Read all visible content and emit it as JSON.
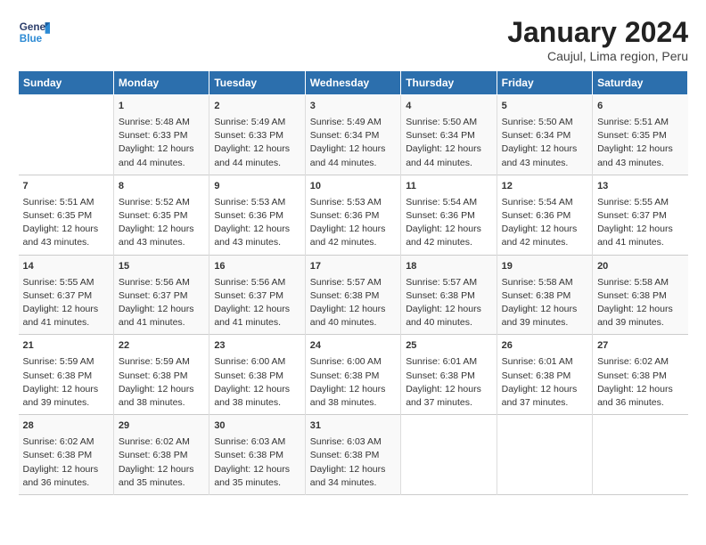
{
  "logo": {
    "line1": "General",
    "line2": "Blue"
  },
  "title": "January 2024",
  "subtitle": "Caujul, Lima region, Peru",
  "days_of_week": [
    "Sunday",
    "Monday",
    "Tuesday",
    "Wednesday",
    "Thursday",
    "Friday",
    "Saturday"
  ],
  "weeks": [
    [
      {
        "day": "",
        "info": ""
      },
      {
        "day": "1",
        "info": "Sunrise: 5:48 AM\nSunset: 6:33 PM\nDaylight: 12 hours\nand 44 minutes."
      },
      {
        "day": "2",
        "info": "Sunrise: 5:49 AM\nSunset: 6:33 PM\nDaylight: 12 hours\nand 44 minutes."
      },
      {
        "day": "3",
        "info": "Sunrise: 5:49 AM\nSunset: 6:34 PM\nDaylight: 12 hours\nand 44 minutes."
      },
      {
        "day": "4",
        "info": "Sunrise: 5:50 AM\nSunset: 6:34 PM\nDaylight: 12 hours\nand 44 minutes."
      },
      {
        "day": "5",
        "info": "Sunrise: 5:50 AM\nSunset: 6:34 PM\nDaylight: 12 hours\nand 43 minutes."
      },
      {
        "day": "6",
        "info": "Sunrise: 5:51 AM\nSunset: 6:35 PM\nDaylight: 12 hours\nand 43 minutes."
      }
    ],
    [
      {
        "day": "7",
        "info": "Sunrise: 5:51 AM\nSunset: 6:35 PM\nDaylight: 12 hours\nand 43 minutes."
      },
      {
        "day": "8",
        "info": "Sunrise: 5:52 AM\nSunset: 6:35 PM\nDaylight: 12 hours\nand 43 minutes."
      },
      {
        "day": "9",
        "info": "Sunrise: 5:53 AM\nSunset: 6:36 PM\nDaylight: 12 hours\nand 43 minutes."
      },
      {
        "day": "10",
        "info": "Sunrise: 5:53 AM\nSunset: 6:36 PM\nDaylight: 12 hours\nand 42 minutes."
      },
      {
        "day": "11",
        "info": "Sunrise: 5:54 AM\nSunset: 6:36 PM\nDaylight: 12 hours\nand 42 minutes."
      },
      {
        "day": "12",
        "info": "Sunrise: 5:54 AM\nSunset: 6:36 PM\nDaylight: 12 hours\nand 42 minutes."
      },
      {
        "day": "13",
        "info": "Sunrise: 5:55 AM\nSunset: 6:37 PM\nDaylight: 12 hours\nand 41 minutes."
      }
    ],
    [
      {
        "day": "14",
        "info": "Sunrise: 5:55 AM\nSunset: 6:37 PM\nDaylight: 12 hours\nand 41 minutes."
      },
      {
        "day": "15",
        "info": "Sunrise: 5:56 AM\nSunset: 6:37 PM\nDaylight: 12 hours\nand 41 minutes."
      },
      {
        "day": "16",
        "info": "Sunrise: 5:56 AM\nSunset: 6:37 PM\nDaylight: 12 hours\nand 41 minutes."
      },
      {
        "day": "17",
        "info": "Sunrise: 5:57 AM\nSunset: 6:38 PM\nDaylight: 12 hours\nand 40 minutes."
      },
      {
        "day": "18",
        "info": "Sunrise: 5:57 AM\nSunset: 6:38 PM\nDaylight: 12 hours\nand 40 minutes."
      },
      {
        "day": "19",
        "info": "Sunrise: 5:58 AM\nSunset: 6:38 PM\nDaylight: 12 hours\nand 39 minutes."
      },
      {
        "day": "20",
        "info": "Sunrise: 5:58 AM\nSunset: 6:38 PM\nDaylight: 12 hours\nand 39 minutes."
      }
    ],
    [
      {
        "day": "21",
        "info": "Sunrise: 5:59 AM\nSunset: 6:38 PM\nDaylight: 12 hours\nand 39 minutes."
      },
      {
        "day": "22",
        "info": "Sunrise: 5:59 AM\nSunset: 6:38 PM\nDaylight: 12 hours\nand 38 minutes."
      },
      {
        "day": "23",
        "info": "Sunrise: 6:00 AM\nSunset: 6:38 PM\nDaylight: 12 hours\nand 38 minutes."
      },
      {
        "day": "24",
        "info": "Sunrise: 6:00 AM\nSunset: 6:38 PM\nDaylight: 12 hours\nand 38 minutes."
      },
      {
        "day": "25",
        "info": "Sunrise: 6:01 AM\nSunset: 6:38 PM\nDaylight: 12 hours\nand 37 minutes."
      },
      {
        "day": "26",
        "info": "Sunrise: 6:01 AM\nSunset: 6:38 PM\nDaylight: 12 hours\nand 37 minutes."
      },
      {
        "day": "27",
        "info": "Sunrise: 6:02 AM\nSunset: 6:38 PM\nDaylight: 12 hours\nand 36 minutes."
      }
    ],
    [
      {
        "day": "28",
        "info": "Sunrise: 6:02 AM\nSunset: 6:38 PM\nDaylight: 12 hours\nand 36 minutes."
      },
      {
        "day": "29",
        "info": "Sunrise: 6:02 AM\nSunset: 6:38 PM\nDaylight: 12 hours\nand 35 minutes."
      },
      {
        "day": "30",
        "info": "Sunrise: 6:03 AM\nSunset: 6:38 PM\nDaylight: 12 hours\nand 35 minutes."
      },
      {
        "day": "31",
        "info": "Sunrise: 6:03 AM\nSunset: 6:38 PM\nDaylight: 12 hours\nand 34 minutes."
      },
      {
        "day": "",
        "info": ""
      },
      {
        "day": "",
        "info": ""
      },
      {
        "day": "",
        "info": ""
      }
    ]
  ],
  "colors": {
    "header_bg": "#2c6fad",
    "header_text": "#ffffff"
  }
}
